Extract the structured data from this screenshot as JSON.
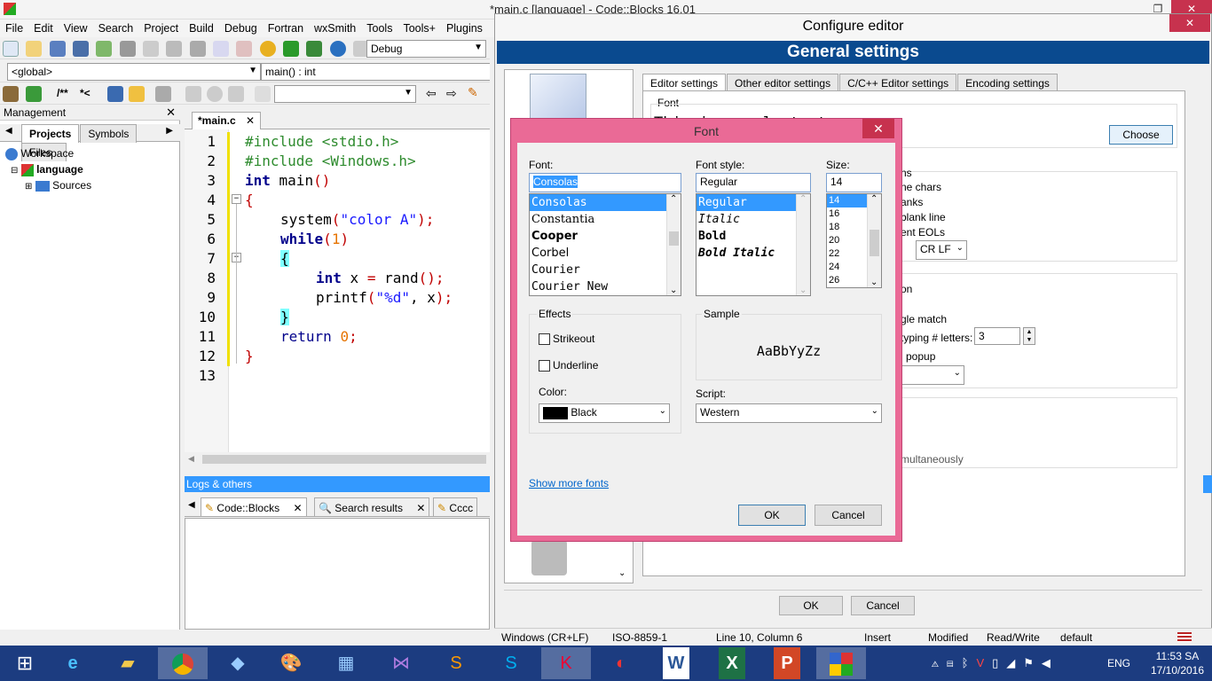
{
  "app": {
    "title": "*main.c [language] - Code::Blocks 16.01",
    "menu": [
      "File",
      "Edit",
      "View",
      "Search",
      "Project",
      "Build",
      "Debug",
      "Fortran",
      "wxSmith",
      "Tools",
      "Tools+",
      "Plugins"
    ]
  },
  "toolbar": {
    "build_target": "Debug",
    "scope": "<global>",
    "function": "main() : int",
    "comment_block": "/**",
    "comment_line": "*<"
  },
  "management": {
    "title": "Management",
    "tabs": [
      "Projects",
      "Symbols",
      "Files"
    ],
    "tree": [
      "Workspace",
      "language",
      "Sources"
    ]
  },
  "editor": {
    "tab_label": "*main.c",
    "line_numbers": [
      "1",
      "2",
      "3",
      "4",
      "5",
      "6",
      "7",
      "8",
      "9",
      "10",
      "11",
      "12",
      "13"
    ],
    "lines": [
      {
        "parts": [
          {
            "t": "#include <stdio.h>",
            "c": "#2e8b2e"
          }
        ],
        "indent": 0
      },
      {
        "parts": [
          {
            "t": "#include <Windows.h>",
            "c": "#2e8b2e"
          }
        ],
        "indent": 0
      },
      {
        "parts": [
          {
            "t": "int",
            "c": "#00008b",
            "b": true
          },
          {
            "t": " main",
            "c": "#000"
          },
          {
            "t": "()",
            "c": "#c00000"
          }
        ],
        "indent": 0
      },
      {
        "parts": [
          {
            "t": "{",
            "c": "#c00000"
          }
        ],
        "indent": 0
      },
      {
        "parts": [
          {
            "t": "system",
            "c": "#000"
          },
          {
            "t": "(",
            "c": "#c00000"
          },
          {
            "t": "\"color A\"",
            "c": "#1a1aff"
          },
          {
            "t": ");",
            "c": "#c00000"
          }
        ],
        "indent": 1
      },
      {
        "parts": [
          {
            "t": "while",
            "c": "#00008b",
            "b": true
          },
          {
            "t": "(",
            "c": "#c00000"
          },
          {
            "t": "1",
            "c": "#e67300"
          },
          {
            "t": ")",
            "c": "#c00000"
          }
        ],
        "indent": 1
      },
      {
        "parts": [
          {
            "t": "{",
            "c": "#000",
            "hl": true
          }
        ],
        "indent": 1
      },
      {
        "parts": [
          {
            "t": "int",
            "c": "#00008b",
            "b": true
          },
          {
            "t": " x ",
            "c": "#000"
          },
          {
            "t": "=",
            "c": "#c00000"
          },
          {
            "t": " rand",
            "c": "#000"
          },
          {
            "t": "();",
            "c": "#c00000"
          }
        ],
        "indent": 2
      },
      {
        "parts": [
          {
            "t": "printf",
            "c": "#000"
          },
          {
            "t": "(",
            "c": "#c00000"
          },
          {
            "t": "\"%d\"",
            "c": "#1a1aff"
          },
          {
            "t": ", x",
            "c": "#000"
          },
          {
            "t": ");",
            "c": "#c00000"
          }
        ],
        "indent": 2
      },
      {
        "parts": [
          {
            "t": "}",
            "c": "#000",
            "hl": true
          }
        ],
        "indent": 1
      },
      {
        "parts": [
          {
            "t": "return",
            "c": "#00008b"
          },
          {
            "t": " ",
            "c": "#000"
          },
          {
            "t": "0",
            "c": "#e67300"
          },
          {
            "t": ";",
            "c": "#c00000"
          }
        ],
        "indent": 1
      },
      {
        "parts": [
          {
            "t": "}",
            "c": "#c00000"
          }
        ],
        "indent": 0
      },
      {
        "parts": [],
        "indent": 0
      }
    ]
  },
  "logs": {
    "title": "Logs & others",
    "tabs": [
      "Code::Blocks",
      "Search results",
      "Cccc"
    ]
  },
  "configure_editor": {
    "title": "Configure editor",
    "banner": "General settings",
    "tabs": [
      "Editor settings",
      "Other editor settings",
      "C/C++ Editor settings",
      "Encoding settings"
    ],
    "font_group": "Font",
    "preview_text": "This is sample text",
    "choose_label": "Choose",
    "partial_labels": [
      "ns",
      "ne chars",
      "anks",
      "blank line",
      "ent EOLs",
      "on",
      "gle match",
      "typing # letters:",
      "n popup",
      "multaneously"
    ],
    "eol_mode": "CR LF",
    "letters_value": "3",
    "ok_label": "OK",
    "cancel_label": "Cancel"
  },
  "font_dialog": {
    "title": "Font",
    "font_label": "Font:",
    "style_label": "Font style:",
    "size_label": "Size:",
    "font_value": "Consolas",
    "style_value": "Regular",
    "size_value": "14",
    "fonts": [
      "Consolas",
      "Constantia",
      "Cooper",
      "Corbel",
      "Courier",
      "Courier New"
    ],
    "styles": [
      "Regular",
      "Italic",
      "Bold",
      "Bold Italic"
    ],
    "sizes": [
      "14",
      "16",
      "18",
      "20",
      "22",
      "24",
      "26"
    ],
    "effects_label": "Effects",
    "strikeout_label": "Strikeout",
    "underline_label": "Underline",
    "color_label": "Color:",
    "color_value": "Black",
    "sample_label": "Sample",
    "sample_text": "AaBbYyZz",
    "script_label": "Script:",
    "script_value": "Western",
    "more_fonts_link": "Show more fonts",
    "ok_label": "OK",
    "cancel_label": "Cancel"
  },
  "statusbar": {
    "eol": "Windows (CR+LF)",
    "encoding": "ISO-8859-1",
    "position": "Line 10, Column 6",
    "mode": "Insert",
    "modified": "Modified",
    "access": "Read/Write",
    "profile": "default"
  },
  "taskbar": {
    "language": "ENG",
    "time": "11:53 SA",
    "date": "17/10/2016"
  },
  "colors": {
    "banner": "#0a4a8f",
    "font_dialog_frame": "#ea6a96",
    "taskbar": "#1c3c80",
    "selection": "#3399ff"
  }
}
